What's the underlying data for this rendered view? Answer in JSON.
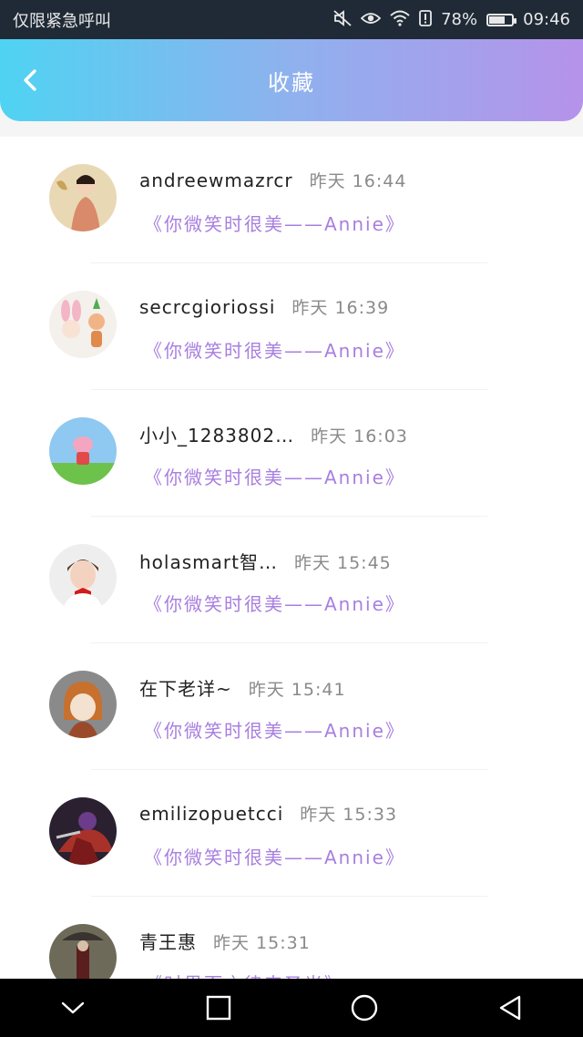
{
  "status_bar": {
    "carrier_text": "仅限紧急呼叫",
    "battery_percent": "78%",
    "battery_level": 0.78,
    "time": "09:46",
    "icons": [
      "mute-icon",
      "eye-icon",
      "wifi-icon",
      "alert-icon",
      "battery-icon"
    ]
  },
  "header": {
    "title": "收藏",
    "back_icon": "chevron-left-icon"
  },
  "favorites": [
    {
      "username": "andreewmazrcr",
      "time": "昨天 16:44",
      "message": "《你微笑时很美——Annie》"
    },
    {
      "username": "secrcgioriossi",
      "time": "昨天 16:39",
      "message": "《你微笑时很美——Annie》"
    },
    {
      "username": "小小_1283802…",
      "time": "昨天 16:03",
      "message": "《你微笑时很美——Annie》"
    },
    {
      "username": "holasmart智…",
      "time": "昨天 15:45",
      "message": "《你微笑时很美——Annie》"
    },
    {
      "username": "在下老详~",
      "time": "昨天 15:41",
      "message": "《你微笑时很美——Annie》"
    },
    {
      "username": "emilizopuetcci",
      "time": "昨天 15:33",
      "message": "《你微笑时很美——Annie》"
    },
    {
      "username": "青王惠",
      "time": "昨天 15:31",
      "message": "《时界而之律来圣光》"
    }
  ],
  "nav_bar": {
    "icons": [
      "chevron-down-icon",
      "square-icon",
      "circle-icon",
      "triangle-back-icon"
    ]
  }
}
